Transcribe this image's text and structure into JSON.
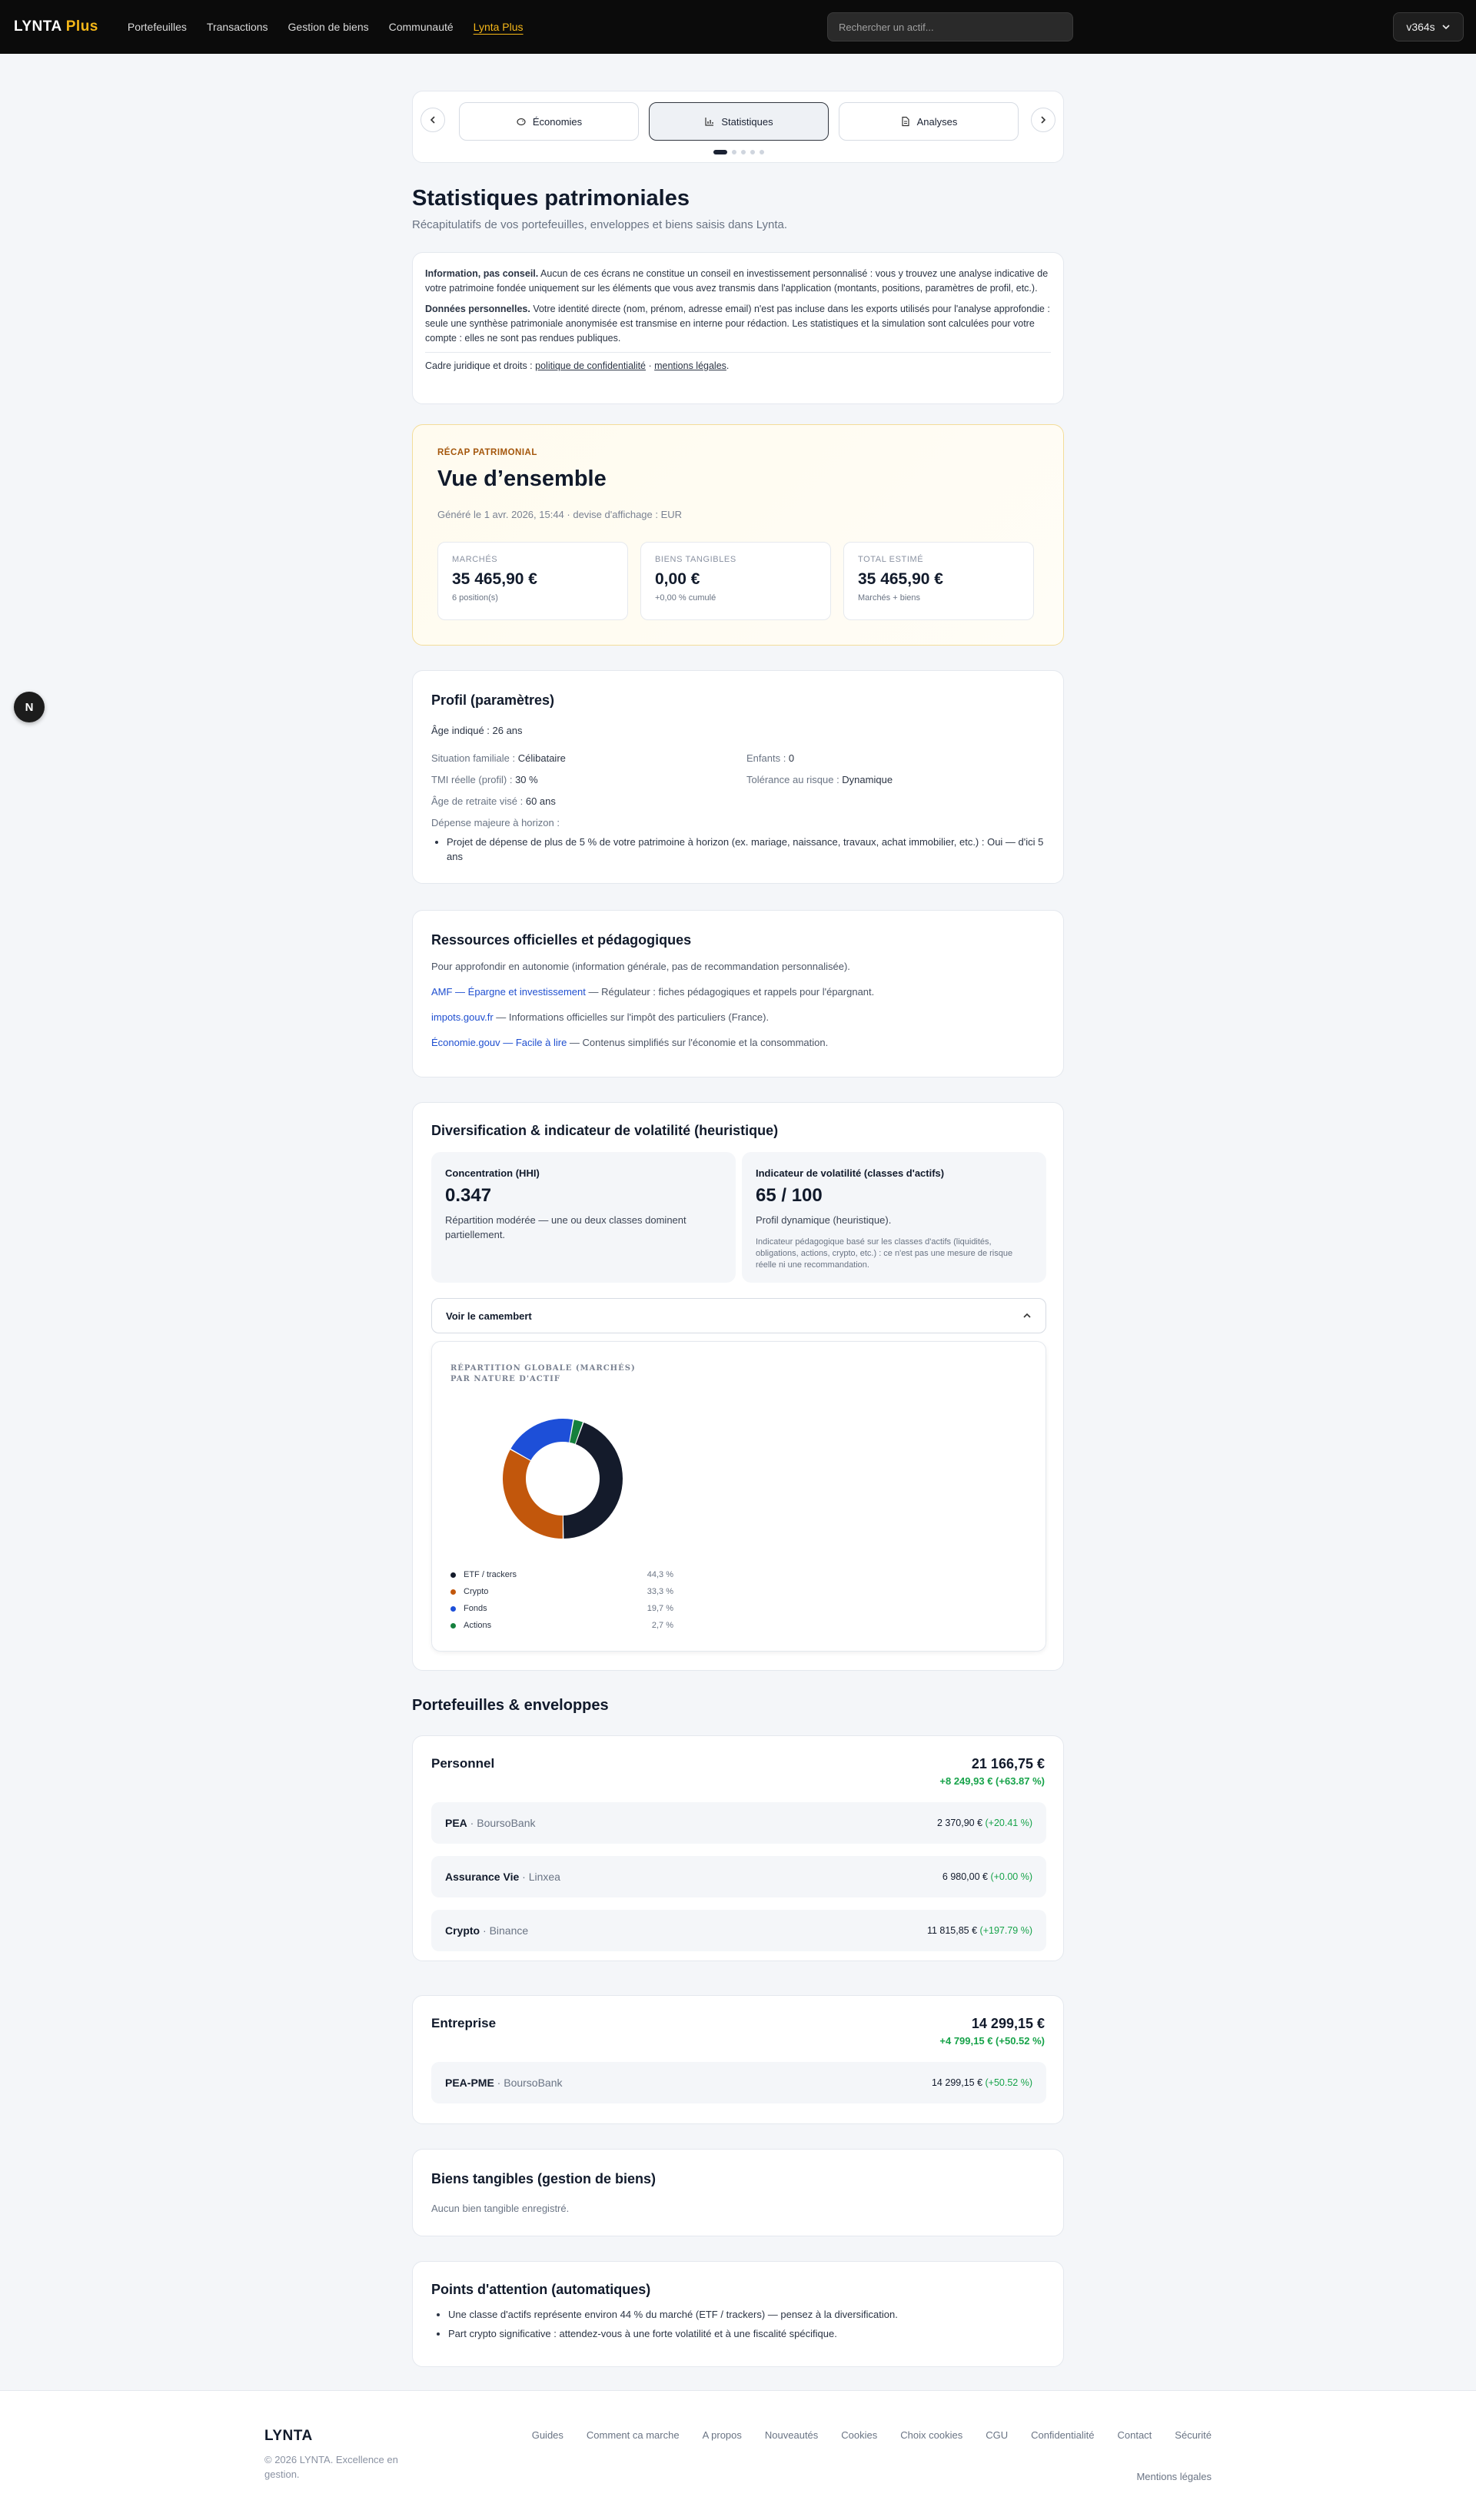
{
  "nav": {
    "logo_main": "LYNTA",
    "logo_plus": "Plus",
    "links": [
      "Portefeuilles",
      "Transactions",
      "Gestion de biens",
      "Communauté",
      "Lynta Plus"
    ],
    "search_placeholder": "Rechercher un actif...",
    "user": "v364s"
  },
  "float_badge": "N",
  "tabs": [
    {
      "label": "Économies",
      "icon": "piggy-bank-icon"
    },
    {
      "label": "Statistiques",
      "icon": "bar-chart-icon"
    },
    {
      "label": "Analyses",
      "icon": "document-icon"
    }
  ],
  "page": {
    "title": "Statistiques patrimoniales",
    "subtitle": "Récapitulatifs de vos portefeuilles, enveloppes et biens saisis dans Lynta."
  },
  "info": {
    "p1_bold": "Information, pas conseil.",
    "p1_text": " Aucun de ces écrans ne constitue un conseil en investissement personnalisé : vous y trouvez une analyse indicative de votre patrimoine fondée uniquement sur les éléments que vous avez transmis dans l'application (montants, positions, paramètres de profil, etc.).",
    "p2_bold": "Données personnelles.",
    "p2_text": " Votre identité directe (nom, prénom, adresse email) n'est pas incluse dans les exports utilisés pour l'analyse approfondie : seule une synthèse patrimoniale anonymisée est transmise en interne pour rédaction. Les statistiques et la simulation sont calculées pour votre compte : elles ne sont pas rendues publiques.",
    "legal_prefix": "Cadre juridique et droits : ",
    "legal_link1": "politique de confidentialité",
    "legal_sep": " · ",
    "legal_link2": "mentions légales",
    "legal_suffix": "."
  },
  "recap": {
    "eyebrow": "RÉCAP PATRIMONIAL",
    "title": "Vue d’ensemble",
    "meta": "Généré le 1 avr. 2026, 15:44 · devise d'affichage : EUR",
    "kpis": [
      {
        "label": "MARCHÉS",
        "value": "35 465,90 €",
        "sub": "6 position(s)"
      },
      {
        "label": "BIENS TANGIBLES",
        "value": "0,00 €",
        "sub": "+0,00 % cumulé"
      },
      {
        "label": "TOTAL ESTIMÉ",
        "value": "35 465,90 €",
        "sub": "Marchés + biens"
      }
    ]
  },
  "profil": {
    "title": "Profil (paramètres)",
    "age": "Âge indiqué : 26 ans",
    "situation_label": "Situation familiale : ",
    "situation_value": "Célibataire",
    "enfants_label": "Enfants : ",
    "enfants_value": "0",
    "tmi_label": "TMI réelle (profil) : ",
    "tmi_value": "30 %",
    "tolerance_label": "Tolérance au risque : ",
    "tolerance_value": "Dynamique",
    "retraite_label": "Âge de retraite visé : ",
    "retraite_value": "60 ans",
    "depense_label": "Dépense majeure à horizon :",
    "depense_item": "Projet de dépense de plus de 5 % de votre patrimoine à horizon (ex. mariage, naissance, travaux, achat immobilier, etc.) : Oui — d'ici 5 ans"
  },
  "ressources": {
    "title": "Ressources officielles et pédagogiques",
    "desc": "Pour approfondir en autonomie (information générale, pas de recommandation personnalisée).",
    "links": [
      {
        "link": "AMF — Épargne et investissement",
        "text": " — Régulateur : fiches pédagogiques et rappels pour l'épargnant."
      },
      {
        "link": "impots.gouv.fr",
        "text": " — Informations officielles sur l'impôt des particuliers (France)."
      },
      {
        "link": "Économie.gouv — Facile à lire",
        "text": " — Contenus simplifiés sur l'économie et la consommation."
      }
    ]
  },
  "diversification": {
    "title": "Diversification & indicateur de volatilité (heuristique)",
    "hhi_title": "Concentration (HHI)",
    "hhi_value": "0.347",
    "hhi_desc": "Répartition modérée — une ou deux classes dominent partiellement.",
    "vol_title": "Indicateur de volatilité (classes d'actifs)",
    "vol_value": "65 / 100",
    "vol_desc": "Profil dynamique (heuristique).",
    "vol_small": "Indicateur pédagogique basé sur les classes d'actifs (liquidités, obligations, actions, crypto, etc.) : ce n'est pas une mesure de risque réelle ni une recommandation.",
    "accordion_label": "Voir le camembert"
  },
  "chart_data": {
    "type": "pie",
    "title": "RÉPARTITION GLOBALE (MARCHÉS) PAR NATURE D'ACTIF",
    "categories": [
      "ETF / trackers",
      "Crypto",
      "Fonds",
      "Actions"
    ],
    "values": [
      44.3,
      33.3,
      19.7,
      2.7
    ],
    "labels": [
      "44,3 %",
      "33,3 %",
      "19,7 %",
      "2,7 %"
    ],
    "colors": [
      "#141b2b",
      "#c2570c",
      "#1d4fd8",
      "#15803d"
    ],
    "legend": "bottom-left",
    "donut": true
  },
  "portefeuilles": {
    "title": "Portefeuilles & enveloppes",
    "groups": [
      {
        "name": "Personnel",
        "total": "21 166,75 €",
        "gain": "+8 249,93 € (+63.87 %)",
        "accounts": [
          {
            "name": "PEA",
            "broker": " · BoursoBank",
            "value": "2 370,90 € ",
            "gain": "(+20.41 %)"
          },
          {
            "name": "Assurance Vie",
            "broker": " · Linxea",
            "value": "6 980,00 € ",
            "gain": "(+0.00 %)"
          },
          {
            "name": "Crypto",
            "broker": " · Binance",
            "value": "11 815,85 € ",
            "gain": "(+197.79 %)"
          }
        ]
      },
      {
        "name": "Entreprise",
        "total": "14 299,15 €",
        "gain": "+4 799,15 € (+50.52 %)",
        "accounts": [
          {
            "name": "PEA-PME",
            "broker": " · BoursoBank",
            "value": "14 299,15 € ",
            "gain": "(+50.52 %)"
          }
        ]
      }
    ]
  },
  "biens": {
    "title": "Biens tangibles (gestion de biens)",
    "empty": "Aucun bien tangible enregistré."
  },
  "points": {
    "title": "Points d'attention (automatiques)",
    "items": [
      "Une classe d'actifs représente environ 44 % du marché (ETF / trackers) — pensez à la diversification.",
      "Part crypto significative : attendez-vous à une forte volatilité et à une fiscalité spécifique."
    ]
  },
  "footer": {
    "logo": "LYNTA",
    "copy": "© 2026 LYNTA. Excellence en gestion.",
    "links": [
      "Guides",
      "Comment ca marche",
      "A propos",
      "Nouveautés",
      "Cookies",
      "Choix cookies",
      "CGU",
      "Confidentialité",
      "Contact",
      "Sécurité"
    ],
    "legal": "Mentions légales"
  }
}
